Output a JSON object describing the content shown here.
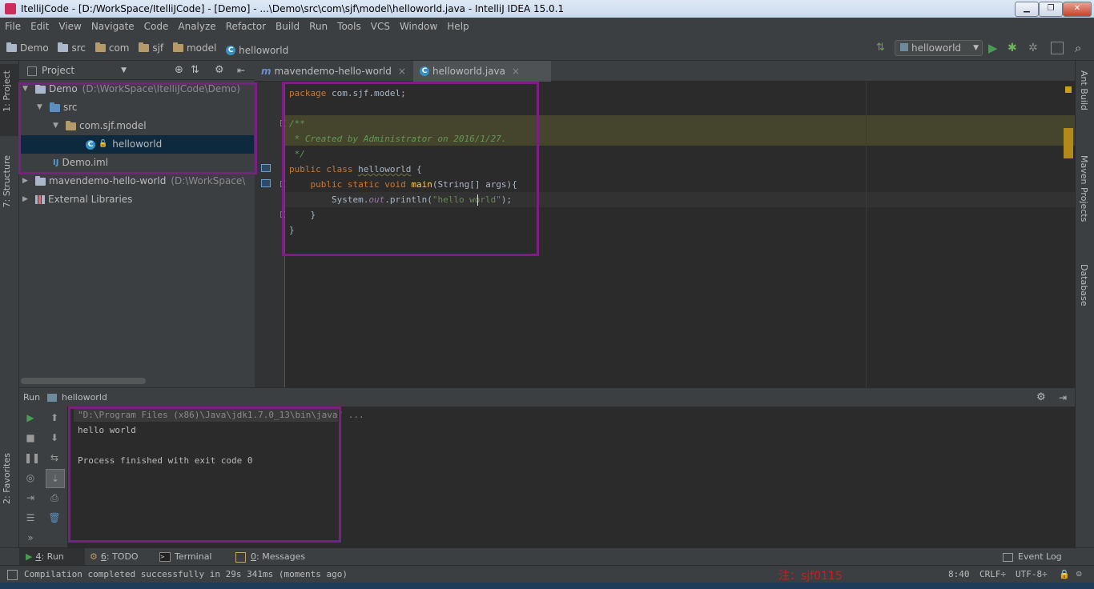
{
  "window": {
    "title": "ItelliJCode - [D:/WorkSpace/ItelliJCode] - [Demo] - ...\\Demo\\src\\com\\sjf\\model\\helloworld.java - IntelliJ IDEA 15.0.1",
    "minimize": "▁",
    "maximize": "❐",
    "close": "✕"
  },
  "menu": [
    "File",
    "Edit",
    "View",
    "Navigate",
    "Code",
    "Analyze",
    "Refactor",
    "Build",
    "Run",
    "Tools",
    "VCS",
    "Window",
    "Help"
  ],
  "breadcrumb": [
    "Demo",
    "src",
    "com",
    "sjf",
    "model",
    "helloworld"
  ],
  "run_config": "helloworld",
  "left_stripe": {
    "project_tab": "1: Project",
    "structure_tab": "7: Structure",
    "favorites_tab": "2: Favorites"
  },
  "right_stripe": {
    "ant": "Ant Build",
    "maven": "Maven Projects",
    "database": "Database"
  },
  "project_panel": {
    "header": "Project",
    "tree": {
      "demo": {
        "name": "Demo",
        "path": "(D:\\WorkSpace\\ItelliJCode\\Demo)"
      },
      "src": "src",
      "package": "com.sjf.model",
      "helloworld": "helloworld",
      "iml": "Demo.iml",
      "maven": {
        "name": "mavendemo-hello-world",
        "path": "(D:\\WorkSpace\\"
      },
      "libs": "External Libraries"
    }
  },
  "editor": {
    "tabs": [
      {
        "label": "mavendemo-hello-world",
        "close": "×"
      },
      {
        "label": "helloworld.java",
        "close": "×"
      }
    ],
    "code": {
      "pkg_kw": "package",
      "pkg_name": " com.sjf.model;",
      "doc_open": "/**",
      "doc_body": " * Created by Administrator on 2016/1/27.",
      "doc_close": " */",
      "class_kw": "public class ",
      "class_name": "helloworld",
      "class_brace": " {",
      "main_indent": "    ",
      "main_kw": "public static void ",
      "main_name": "main",
      "main_args": "(String[] args){",
      "print_indent": "        ",
      "print_sys": "System.",
      "print_out": "out",
      "print_call": ".println(",
      "print_str": "\"hello world\"",
      "print_end": ");",
      "close1": "    }",
      "close2": "}"
    }
  },
  "run_panel": {
    "label": "Run",
    "config": "helloworld",
    "console": {
      "line1": "\"D:\\Program Files (x86)\\Java\\jdk1.7.0_13\\bin\\java\" ...",
      "line2": "hello world",
      "line3": "Process finished with exit code 0"
    }
  },
  "bottom_tabs": {
    "run": {
      "num": "4",
      "label": ": Run"
    },
    "todo": {
      "num": "6",
      "label": ": TODO"
    },
    "terminal": "Terminal",
    "messages": {
      "num": "0",
      "label": ": Messages"
    },
    "event_log": "Event Log"
  },
  "status": {
    "message": "Compilation completed successfully in 29s 341ms (moments ago)",
    "position": "8:40",
    "line_sep": "CRLF÷",
    "encoding": "UTF-8÷",
    "watermark": "注：sjf0115"
  },
  "colors": {
    "annotation": "#7b1f82",
    "bg": "#3c3f41",
    "editor_bg": "#2b2b2b"
  }
}
